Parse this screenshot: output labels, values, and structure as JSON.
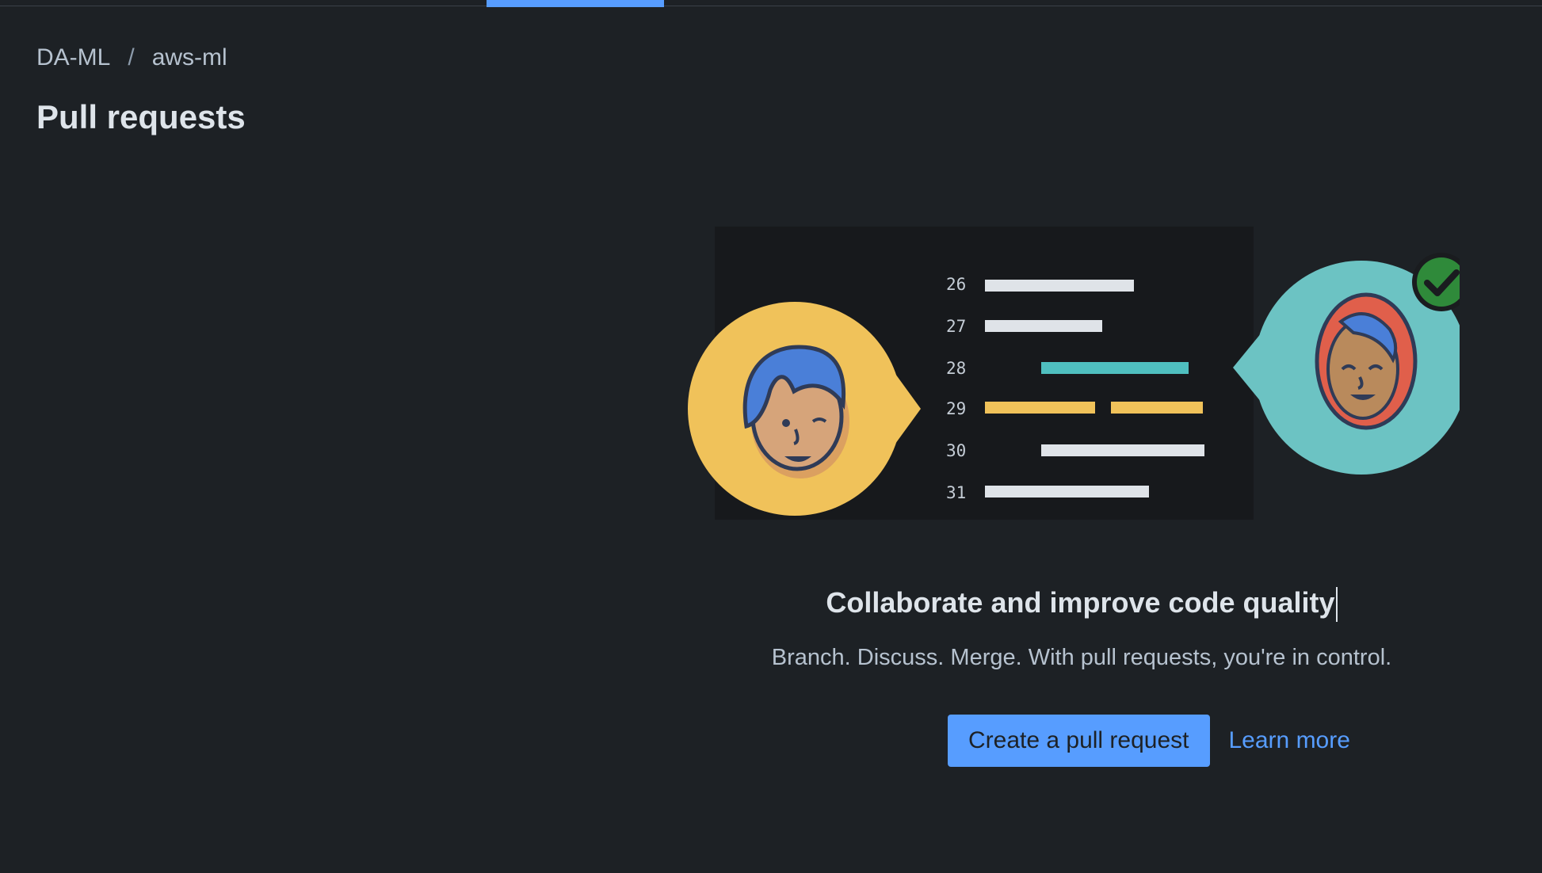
{
  "breadcrumb": {
    "workspace": "DA-ML",
    "separator": "/",
    "repository": "aws-ml"
  },
  "page": {
    "title": "Pull requests"
  },
  "empty_state": {
    "line_numbers": [
      "26",
      "27",
      "28",
      "29",
      "30",
      "31"
    ],
    "heading": "Collaborate and improve code quality",
    "description": "Branch. Discuss. Merge. With pull requests, you're in control.",
    "primary_action": "Create a pull request",
    "secondary_action": "Learn more"
  },
  "colors": {
    "background": "#1d2125",
    "accent": "#579dff",
    "reviewer_bubble": "#f0c25a",
    "approver_bubble": "#6cc3c3",
    "approved_check": "#2f8a3a"
  },
  "icons": {
    "approved": "check-circle-icon"
  }
}
